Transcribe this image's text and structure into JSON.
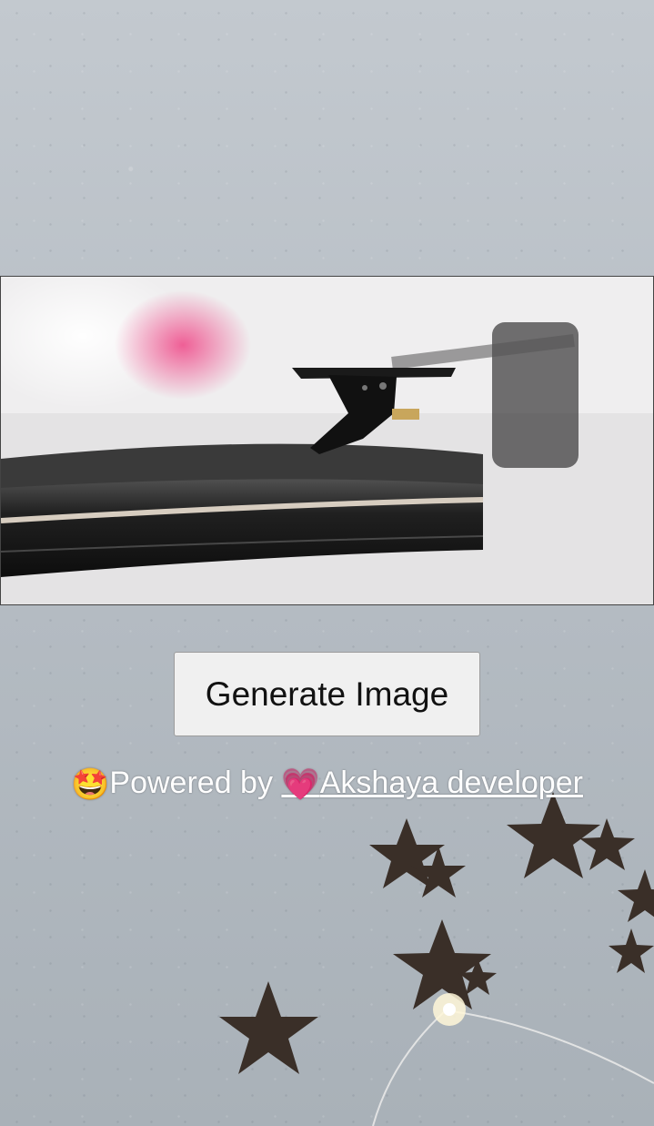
{
  "main": {
    "button_label": "Generate Image"
  },
  "footer": {
    "prefix_emoji": "🤩",
    "powered_text": "Powered by ",
    "heart_emoji": "💗",
    "developer_name": "Akshaya developer"
  },
  "decorations": {
    "photo_icon": "turntable-photo",
    "background_icon": "star-confetti"
  },
  "colors": {
    "button_bg": "#f0f0f0",
    "text_white": "#ffffff",
    "heart": "#f05aa0"
  }
}
